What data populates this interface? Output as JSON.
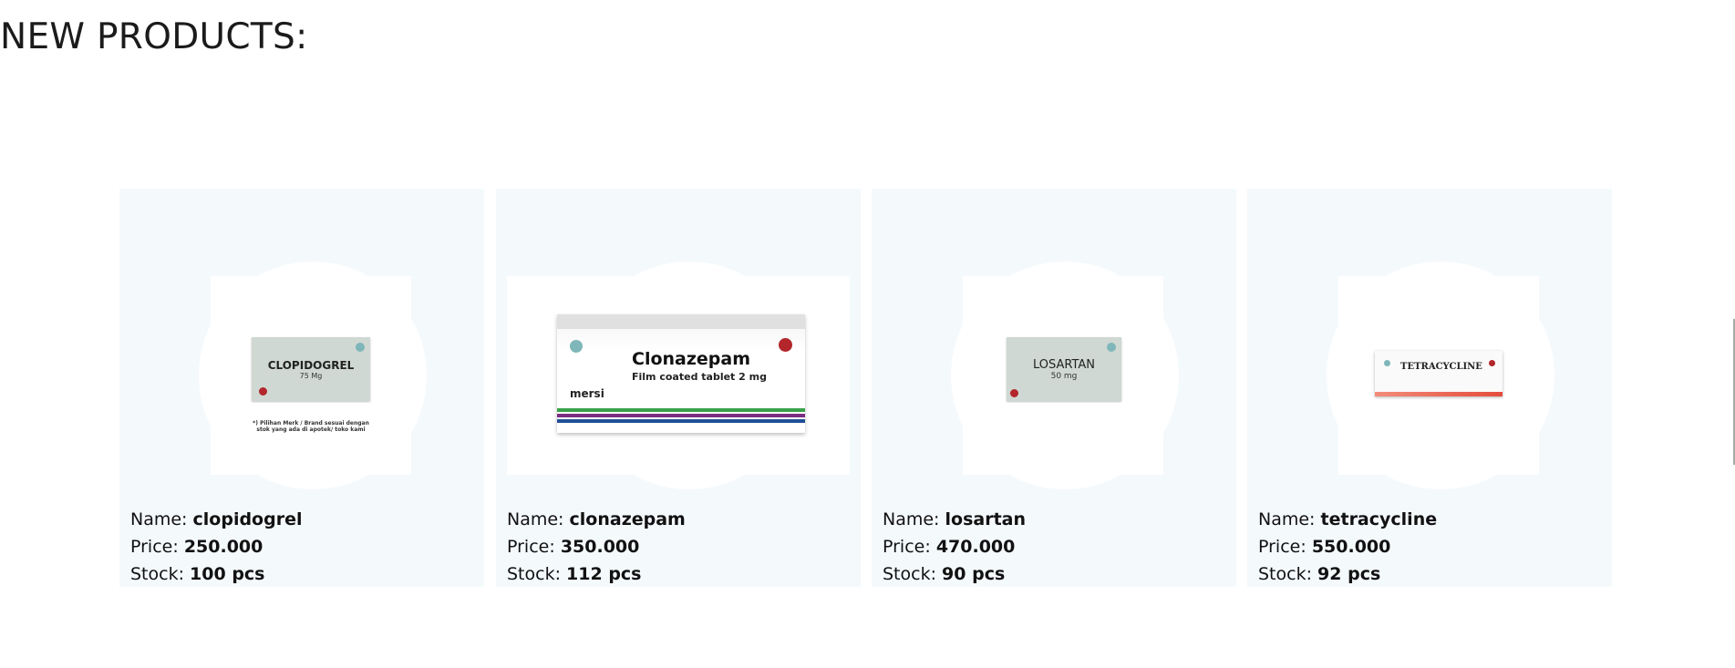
{
  "section": {
    "title": "NEW PRODUCTS:"
  },
  "labels": {
    "name": "Name:",
    "price": "Price:",
    "stock": "Stock:"
  },
  "products": [
    {
      "name": "clopidogrel",
      "price": "250.000",
      "stock": "100 pcs",
      "box_name": "CLOPIDOGREL",
      "box_dose": "75 Mg",
      "box_note": "*) Pilihan Merk / Brand sesuai dengan stok yang ada di apotek/ toko kami"
    },
    {
      "name": "clonazepam",
      "price": "350.000",
      "stock": "112 pcs",
      "box_name": "Clonazepam",
      "box_dose": "Film coated tablet 2 mg",
      "box_brand": "mersi"
    },
    {
      "name": "losartan",
      "price": "470.000",
      "stock": "90 pcs",
      "box_name": "LOSARTAN",
      "box_dose": "50 mg"
    },
    {
      "name": "tetracycline",
      "price": "550.000",
      "stock": "92 pcs",
      "box_name": "TETRACYCLINE"
    }
  ],
  "colors": {
    "card_bg": "#f4f9fc",
    "stripe_green": "#3aa14a",
    "stripe_purple": "#7b2d82",
    "stripe_blue": "#1f4f96"
  }
}
